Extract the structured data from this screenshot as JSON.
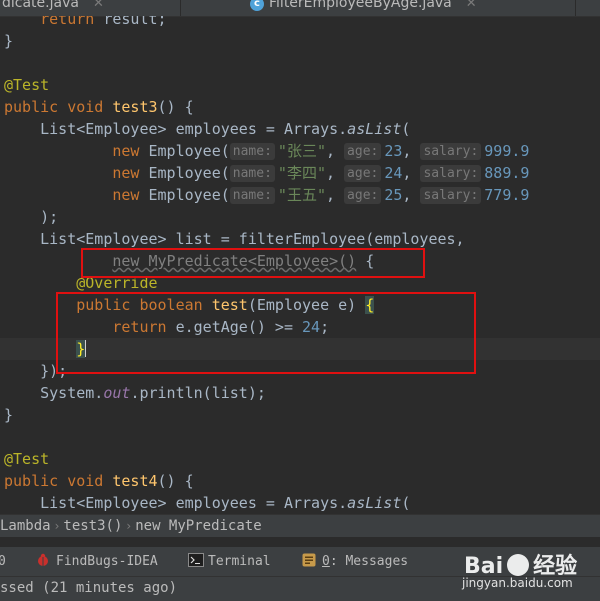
{
  "tabs": [
    {
      "label": "dicate.java"
    },
    {
      "label": "FilterEmployeeByAge.java"
    }
  ],
  "code": {
    "l1_return": "return",
    "l1_result": " result;",
    "l2": "}",
    "l4_annotation": "@Test",
    "l5_public": "public",
    "l5_void": "void",
    "l5_method": "test3",
    "l5_rest": "() {",
    "l6_type": "List<Employee> employees = Arrays.",
    "l6_call": "asList",
    "l6_paren": "(",
    "emp_new": "new",
    "emp_ctor": " Employee(",
    "hint_name": "name:",
    "hint_age": "age:",
    "hint_salary": "salary:",
    "emp1_name": "\"张三\"",
    "emp1_age": "23",
    "emp1_salary": "999.9",
    "emp2_name": "\"李四\"",
    "emp2_age": "24",
    "emp2_salary": "889.9",
    "emp3_name": "\"王五\"",
    "emp3_age": "25",
    "emp3_salary": "779.9",
    "comma": ",",
    "l10": ");",
    "l11": "List<Employee> list = filterEmployee(employees,",
    "l12_anon": "new MyPredicate<Employee>()",
    "l12_brace": " {",
    "l13_override": "@Override",
    "l14_public": "public",
    "l14_boolean": "boolean",
    "l14_method": "test",
    "l14_params": "(Employee e) ",
    "l14_brace": "{",
    "l15_return": "return",
    "l15_expr": " e.getAge() >= ",
    "l15_num": "24",
    "l15_semi": ";",
    "l16_brace": "}",
    "l17": "});",
    "l18_sys": "System.",
    "l18_out": "out",
    "l18_rest": ".println(list);",
    "l19": "}",
    "l21_annotation": "@Test",
    "l22_public": "public",
    "l22_void": "void",
    "l22_method": "test4",
    "l22_rest": "() {",
    "l23_type": "List<Employee> employees = Arrays.",
    "l23_call": "asList",
    "l23_paren": "("
  },
  "breadcrumb": [
    "Lambda",
    "test3()",
    "new MyPredicate"
  ],
  "toolbar": {
    "item0": "0",
    "findbugs": "FindBugs-IDEA",
    "terminal": "Terminal",
    "messages_num": "0",
    "messages": ": Messages"
  },
  "status": {
    "text": "ssed (21 minutes ago)"
  },
  "watermark": {
    "brand": "Bai",
    "brand2": "经验",
    "url": "jingyan.baidu.com"
  },
  "colors": {
    "highlight_box": "#e01010",
    "background": "#2b2b2b"
  }
}
